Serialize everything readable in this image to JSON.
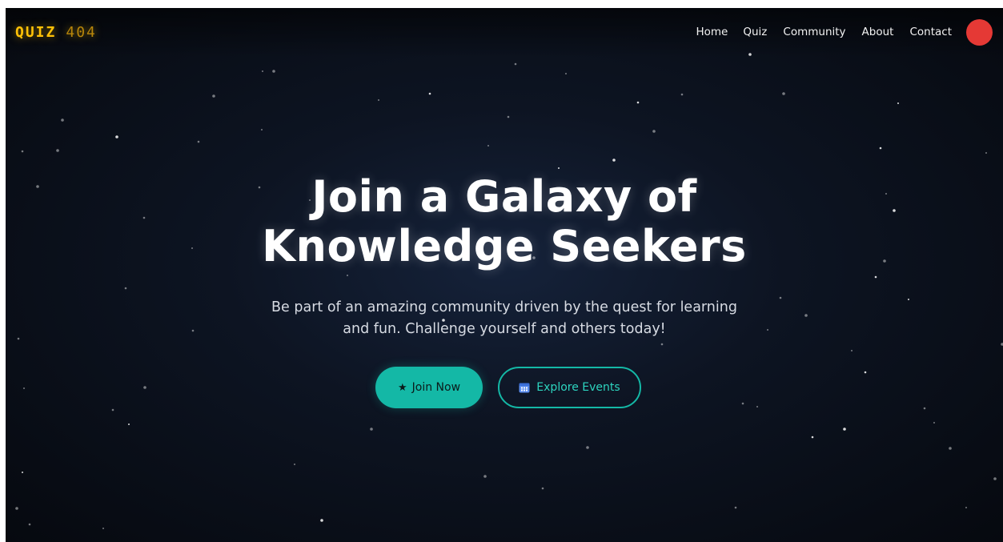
{
  "logo": {
    "main": "QUIZ",
    "number": "404",
    "color": "#ffc107"
  },
  "nav": {
    "items": [
      {
        "label": "Home"
      },
      {
        "label": "Quiz"
      },
      {
        "label": "Community"
      },
      {
        "label": "About"
      },
      {
        "label": "Contact"
      }
    ],
    "profile_color": "#e53935"
  },
  "hero": {
    "title_line1": "Join a Galaxy of",
    "title_line2": "Knowledge Seekers",
    "subtitle_line1": "Be part of an amazing community driven by the quest for learning",
    "subtitle_line2": "and fun. Challenge yourself and others today!"
  },
  "actions": {
    "primary": {
      "label": "Join Now",
      "icon": "star-icon"
    },
    "secondary": {
      "label": "Explore Events",
      "icon": "calendar-icon"
    },
    "accent_color": "#14b8a6"
  }
}
